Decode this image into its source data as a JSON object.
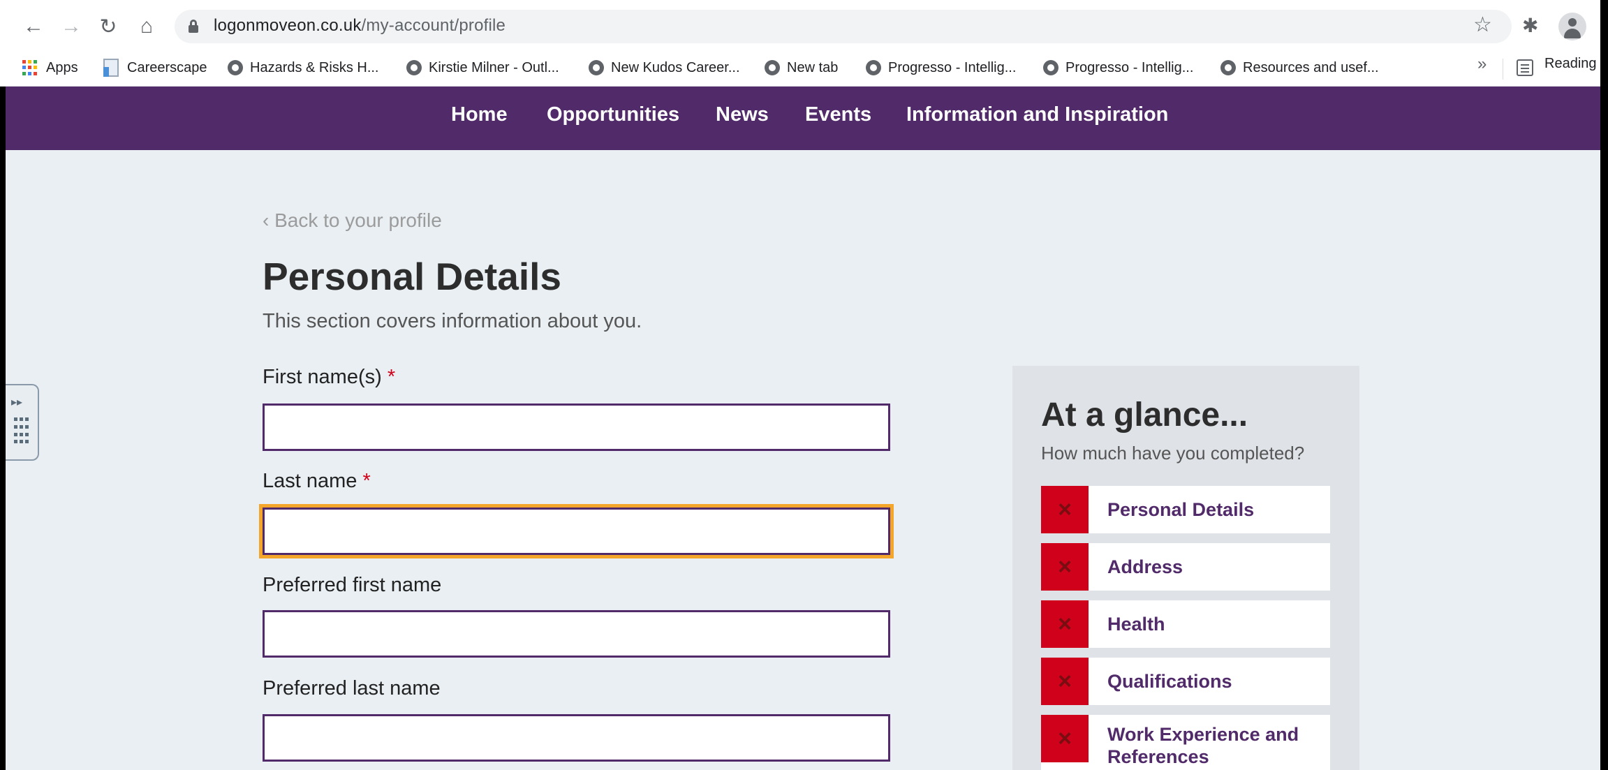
{
  "browser": {
    "url_host": "logonmoveon.co.uk",
    "url_path": "/my-account/profile",
    "bookmarks": [
      {
        "label": "Apps"
      },
      {
        "label": "Careerscape"
      },
      {
        "label": "Hazards & Risks  H..."
      },
      {
        "label": "Kirstie Milner - Outl..."
      },
      {
        "label": "New Kudos Career..."
      },
      {
        "label": "New tab"
      },
      {
        "label": "Progresso - Intellig..."
      },
      {
        "label": "Progresso - Intellig..."
      },
      {
        "label": "Resources and usef..."
      }
    ],
    "overflow": "»",
    "reading_list": "Reading"
  },
  "nav": [
    "Home",
    "Opportunities",
    "News",
    "Events",
    "Information and Inspiration"
  ],
  "page": {
    "back_link": "‹ Back to your profile",
    "title": "Personal Details",
    "subtitle": "This section covers information about you."
  },
  "form": {
    "first_name": {
      "label": "First name(s)",
      "required_mark": "*",
      "value": ""
    },
    "last_name": {
      "label": "Last name",
      "required_mark": "*",
      "value": ""
    },
    "preferred_first": {
      "label": "Preferred first name",
      "value": ""
    },
    "preferred_last": {
      "label": "Preferred last name",
      "value": ""
    }
  },
  "glance": {
    "title": "At a glance...",
    "question": "How much have you completed?",
    "status_icon": "×",
    "items": [
      {
        "label": "Personal Details",
        "complete": false
      },
      {
        "label": "Address",
        "complete": false
      },
      {
        "label": "Health",
        "complete": false
      },
      {
        "label": "Qualifications",
        "complete": false
      },
      {
        "label": "Work Experience and References",
        "complete": false
      }
    ]
  },
  "colors": {
    "brand": "#512a69",
    "incomplete": "#d0021b",
    "focus": "#f4a62a"
  }
}
